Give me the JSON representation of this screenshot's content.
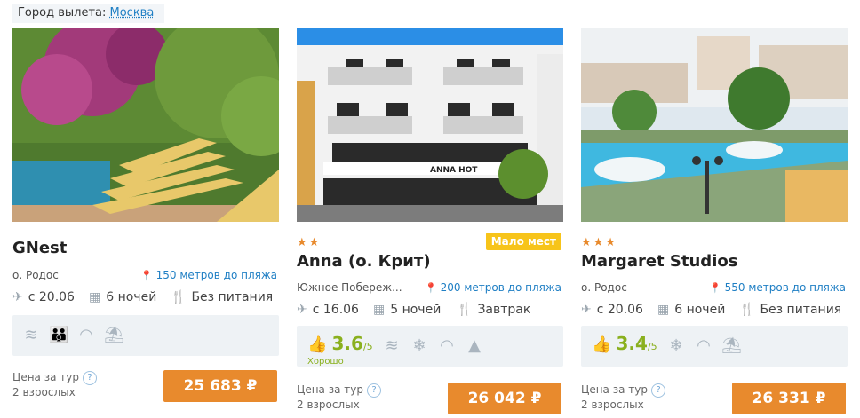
{
  "city": {
    "label": "Город вылета:",
    "value": "Москва"
  },
  "cards": [
    {
      "stars": "",
      "badge": "",
      "name": "GNest",
      "region": "о. Родос",
      "beach": "150 метров до пляжа",
      "date": "с 20.06",
      "nights": "6 ночей",
      "meal": "Без питания",
      "amenities": [
        "pool-icon",
        "family-icon",
        "wifi-icon",
        "beach-icon"
      ],
      "price_label": "Цена за тур",
      "guests": "2 взрослых",
      "price": "25 683 ₽"
    },
    {
      "stars": "★★",
      "badge": "Мало мест",
      "name": "Anna (о. Крит)",
      "region": "Южное Побереж...",
      "beach": "200 метров до пляжа",
      "date": "с 16.06",
      "nights": "5 ночей",
      "meal": "Завтрак",
      "rating": {
        "score": "3.6",
        "of": "/5",
        "caption": "Хорошо"
      },
      "amenities": [
        "pool-icon",
        "ac-icon",
        "wifi-icon",
        "mountain-icon"
      ],
      "price_label": "Цена за тур",
      "guests": "2 взрослых",
      "price": "26 042 ₽"
    },
    {
      "stars": "★★★",
      "badge": "",
      "name": "Margaret Studios",
      "region": "о. Родос",
      "beach": "550 метров до пляжа",
      "date": "с 20.06",
      "nights": "6 ночей",
      "meal": "Без питания",
      "rating": {
        "score": "3.4",
        "of": "/5",
        "caption": ""
      },
      "amenities": [
        "ac-icon",
        "wifi-icon",
        "beach-icon"
      ],
      "price_label": "Цена за тур",
      "guests": "2 взрослых",
      "price": "26 331 ₽"
    }
  ]
}
